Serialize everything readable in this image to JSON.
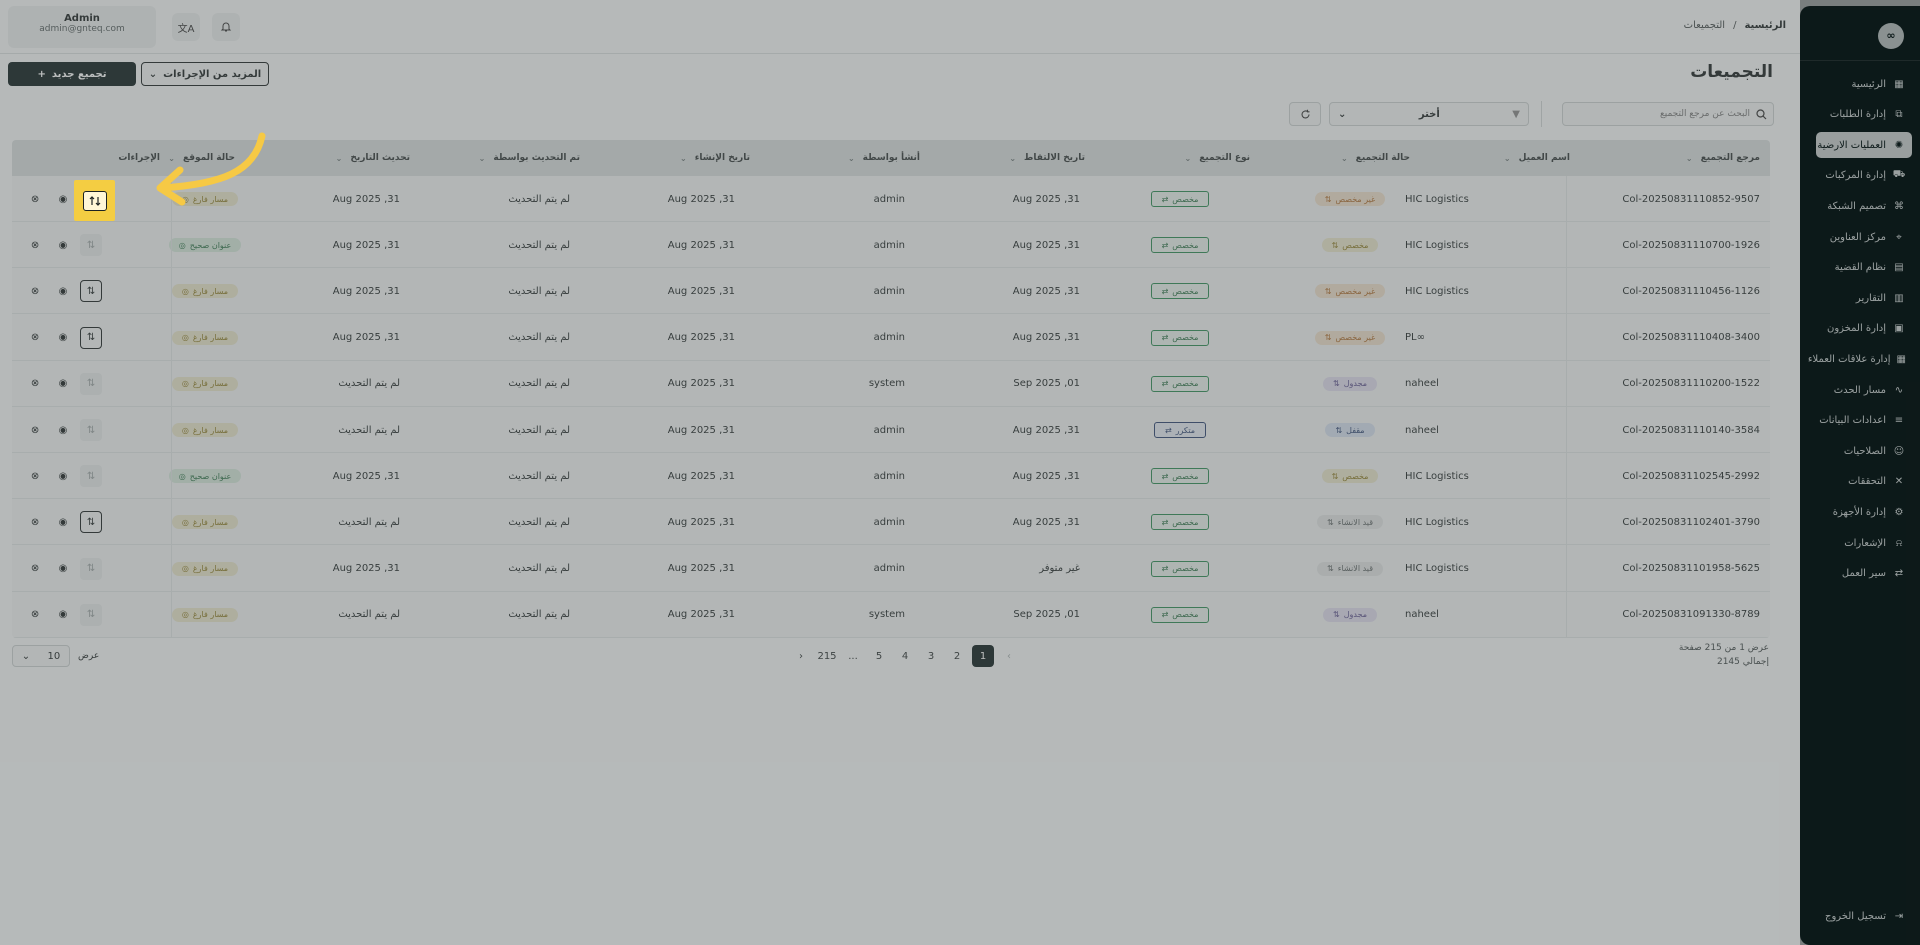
{
  "header": {
    "user_name": "Admin",
    "user_email": "admin@gnteq.com",
    "breadcrumb": {
      "home": "الرئيسية",
      "separator": "/",
      "current": "التجميعات"
    }
  },
  "sidebar": {
    "logo": "∞",
    "items": [
      {
        "label": "الرئيسية",
        "icon": "dashboard-icon"
      },
      {
        "label": "إدارة الطلبات",
        "icon": "orders-icon"
      },
      {
        "label": "العمليات الارضية",
        "icon": "ground-ops-icon"
      },
      {
        "label": "إدارة المركبات",
        "icon": "truck-icon"
      },
      {
        "label": "تصميم الشبكة",
        "icon": "network-icon"
      },
      {
        "label": "مركز العناوين",
        "icon": "location-icon"
      },
      {
        "label": "نظام القضية",
        "icon": "case-icon"
      },
      {
        "label": "التقارير",
        "icon": "reports-icon"
      },
      {
        "label": "إدارة المخزون",
        "icon": "inventory-icon"
      },
      {
        "label": "إدارة علاقات العملاء",
        "icon": "crm-icon"
      },
      {
        "label": "مسار الحدث",
        "icon": "route-icon"
      },
      {
        "label": "اعدادات البيانات",
        "icon": "database-icon"
      },
      {
        "label": "الصلاحيات",
        "icon": "users-icon"
      },
      {
        "label": "التحققات",
        "icon": "tools-icon"
      },
      {
        "label": "إدارة الأجهزة",
        "icon": "device-icon"
      },
      {
        "label": "الإشعارات",
        "icon": "bell-icon"
      },
      {
        "label": "سير العمل",
        "icon": "workflow-icon"
      }
    ],
    "logout": "تسجيل الخروج"
  },
  "page": {
    "title": "التجميعات",
    "new_button": "تجميع جديد",
    "more_button": "المزيد من الإجراءات",
    "search_placeholder": "البحث عن مرجع التجميع",
    "filter_value": "أختر"
  },
  "table": {
    "columns": [
      "مرجع التجميع",
      "اسم العميل",
      "حالة التجميع",
      "نوع التجميع",
      "تاريخ الالتقاط",
      "أنشأ بواسطة",
      "تاريخ الإنشاء",
      "تم التحديث بواسطة",
      "تحديث التاريخ",
      "حالة الموقع",
      "الإجراءات"
    ],
    "rows": [
      {
        "ref": "Col-20250831110852-9507",
        "client": "HIC Logistics",
        "status": "غير مخصص",
        "status_color": "orange",
        "type": "مخصص",
        "pickup": "31, Aug 2025",
        "created_by": "admin",
        "created": "31, Aug 2025",
        "updated_by": "لم يتم التحديث",
        "updated": "31, Aug 2025",
        "location": "مسار فارغ",
        "location_color": "yellow",
        "action": "highlight"
      },
      {
        "ref": "Col-20250831110700-1926",
        "client": "HIC Logistics",
        "status": "مخصص",
        "status_color": "yellow",
        "type": "مخصص",
        "pickup": "31, Aug 2025",
        "created_by": "admin",
        "created": "31, Aug 2025",
        "updated_by": "لم يتم التحديث",
        "updated": "31, Aug 2025",
        "location": "عنوان صحيح",
        "location_color": "green",
        "action": "dim"
      },
      {
        "ref": "Col-20250831110456-1126",
        "client": "HIC Logistics",
        "status": "غير مخصص",
        "status_color": "orange",
        "type": "مخصص",
        "pickup": "31, Aug 2025",
        "created_by": "admin",
        "created": "31, Aug 2025",
        "updated_by": "لم يتم التحديث",
        "updated": "31, Aug 2025",
        "location": "مسار فارغ",
        "location_color": "yellow",
        "action": "boxed"
      },
      {
        "ref": "Col-20250831110408-3400",
        "client": "PL∞",
        "status": "غير مخصص",
        "status_color": "orange",
        "type": "مخصص",
        "pickup": "31, Aug 2025",
        "created_by": "admin",
        "created": "31, Aug 2025",
        "updated_by": "لم يتم التحديث",
        "updated": "31, Aug 2025",
        "location": "مسار فارغ",
        "location_color": "yellow",
        "action": "boxed"
      },
      {
        "ref": "Col-20250831110200-1522",
        "client": "naheel",
        "status": "مجدول",
        "status_color": "purple",
        "type": "مخصص",
        "pickup": "01, Sep 2025",
        "created_by": "system",
        "created": "31, Aug 2025",
        "updated_by": "لم يتم التحديث",
        "updated": "لم يتم التحديث",
        "location": "مسار فارغ",
        "location_color": "yellow",
        "action": "dim"
      },
      {
        "ref": "Col-20250831110140-3584",
        "client": "naheel",
        "status": "مقفل",
        "status_color": "blue",
        "type": "متكرر",
        "type_color": "blue",
        "pickup": "31, Aug 2025",
        "created_by": "admin",
        "created": "31, Aug 2025",
        "updated_by": "لم يتم التحديث",
        "updated": "لم يتم التحديث",
        "location": "مسار فارغ",
        "location_color": "yellow",
        "action": "dim"
      },
      {
        "ref": "Col-20250831102545-2992",
        "client": "HIC Logistics",
        "status": "مخصص",
        "status_color": "yellow",
        "type": "مخصص",
        "pickup": "31, Aug 2025",
        "created_by": "admin",
        "created": "31, Aug 2025",
        "updated_by": "لم يتم التحديث",
        "updated": "31, Aug 2025",
        "location": "عنوان صحيح",
        "location_color": "green",
        "action": "dim"
      },
      {
        "ref": "Col-20250831102401-3790",
        "client": "HIC Logistics",
        "status": "قيد الانشاء",
        "status_color": "gray",
        "type": "مخصص",
        "pickup": "31, Aug 2025",
        "created_by": "admin",
        "created": "31, Aug 2025",
        "updated_by": "لم يتم التحديث",
        "updated": "لم يتم التحديث",
        "location": "مسار فارغ",
        "location_color": "yellow",
        "action": "boxed"
      },
      {
        "ref": "Col-20250831101958-5625",
        "client": "HIC Logistics",
        "status": "قيد الانشاء",
        "status_color": "gray",
        "type": "مخصص",
        "pickup": "غير متوفر",
        "created_by": "admin",
        "created": "31, Aug 2025",
        "updated_by": "لم يتم التحديث",
        "updated": "31, Aug 2025",
        "location": "مسار فارغ",
        "location_color": "yellow",
        "action": "dim"
      },
      {
        "ref": "Col-20250831091330-8789",
        "client": "naheel",
        "status": "مجدول",
        "status_color": "purple",
        "type": "مخصص",
        "pickup": "01, Sep 2025",
        "created_by": "system",
        "created": "31, Aug 2025",
        "updated_by": "لم يتم التحديث",
        "updated": "لم يتم التحديث",
        "location": "مسار فارغ",
        "location_color": "yellow",
        "action": "dim"
      }
    ]
  },
  "pagination": {
    "pages": [
      "1",
      "2",
      "3",
      "4",
      "5",
      "...",
      "215"
    ],
    "current": "1",
    "summary_line1": "عرض 1 من 215 صفحة",
    "summary_line2": "إجمالي 2145",
    "page_size_label": "عرض",
    "page_size": "10"
  }
}
